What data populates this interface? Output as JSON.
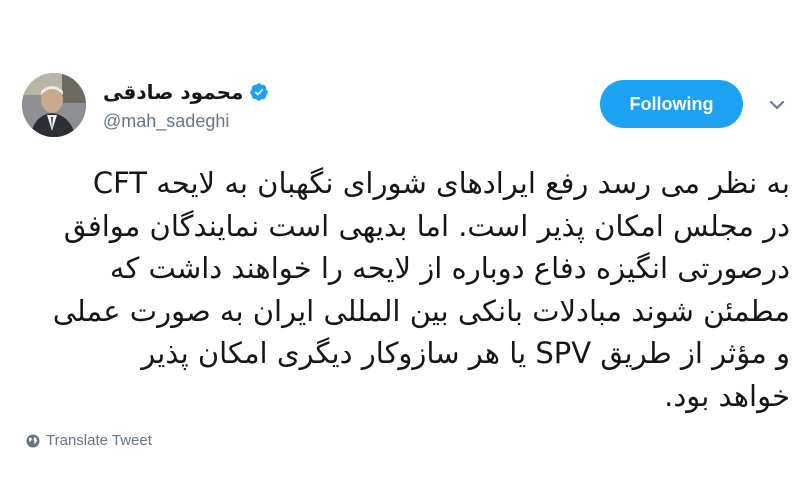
{
  "author": {
    "display_name": "محمود صادقی",
    "handle": "@mah_sadeghi",
    "verified": true
  },
  "follow_button": {
    "label": "Following"
  },
  "tweet": {
    "lines": [
      "به نظر می رسد رفع ایرادهای شورای نگهبان به لایحه CFT",
      "در مجلس امکان پذیر است. اما بدیهی است نمایندگان موافق",
      "درصورتی انگیزه دفاع دوباره از لایحه را خواهند داشت که",
      "مطمئن شوند مبادلات بانکی بین المللی ایران به صورت عملی",
      "و مؤثر از طریق SPV یا هر سازوکار دیگری امکان پذیر",
      "خواهد بود."
    ]
  },
  "translate": {
    "label": "Translate Tweet"
  },
  "colors": {
    "accent": "#1da1f2",
    "text": "#14171a",
    "secondary": "#657786"
  },
  "icons": {
    "verified": "verified-badge-icon",
    "caret": "chevron-down-icon",
    "globe": "globe-icon"
  }
}
